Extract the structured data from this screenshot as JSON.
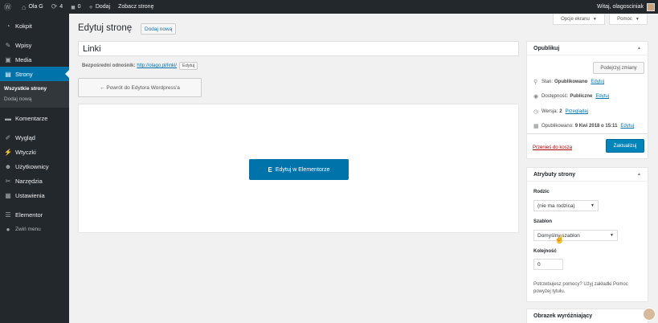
{
  "adminbar": {
    "wp_icon": "wordpress-logo-icon",
    "site": "Ola G",
    "updates": "4",
    "comments": "0",
    "new": "Dodaj",
    "view": "Zobacz stronę",
    "greeting": "Witaj, olagosciniak"
  },
  "sidebar": {
    "items": [
      {
        "label": "Kokpit",
        "icon": "dashboard-icon"
      },
      {
        "label": "Wpisy",
        "icon": "pin-icon"
      },
      {
        "label": "Media",
        "icon": "media-icon"
      },
      {
        "label": "Strony",
        "icon": "pages-icon"
      },
      {
        "label": "Komentarze",
        "icon": "comments-icon"
      },
      {
        "label": "Wygląd",
        "icon": "brush-icon"
      },
      {
        "label": "Wtyczki",
        "icon": "plugin-icon"
      },
      {
        "label": "Użytkownicy",
        "icon": "users-icon"
      },
      {
        "label": "Narzędzia",
        "icon": "tools-icon"
      },
      {
        "label": "Ustawienia",
        "icon": "settings-icon"
      },
      {
        "label": "Elementor",
        "icon": "elementor-icon"
      },
      {
        "label": "Zwiń menu",
        "icon": "collapse-icon"
      }
    ],
    "submenu": [
      "Wszystkie strony",
      "Dodaj nową"
    ]
  },
  "screen_options": "Opcje ekranu",
  "help": "Pomoc",
  "main": {
    "title": "Edytuj stronę",
    "add_new": "Dodaj nową",
    "post_title": "Linki",
    "permalink_label": "Bezpośredni odnośnik:",
    "permalink_url": "http://olago.pl/linki/",
    "permalink_edit": "Edytuj",
    "back_button": "← Powrót do Edytora Wordpress'a",
    "elementor_button": "Edytuj w Elementorze",
    "elementor_glyph": "E"
  },
  "publish": {
    "title": "Opublikuj",
    "preview": "Podejrzyj zmiany",
    "status_label": "Stan:",
    "status_value": "Opublikowano",
    "visibility_label": "Dostępność:",
    "visibility_value": "Publiczne",
    "revisions_label": "Wersja:",
    "revisions_value": "2",
    "revisions_link": "Przeglądaj",
    "published_label": "Opublikowano:",
    "published_value": "9 Kwi 2018 o 15:11",
    "edit": "Edytuj",
    "trash": "Przenieś do kosza",
    "update": "Zaktualizuj"
  },
  "attributes": {
    "title": "Atrybuty strony",
    "parent_label": "Rodzic",
    "parent_value": "(nie ma rodzica)",
    "template_label": "Szablon",
    "template_value": "Domyślny szablon",
    "order_label": "Kolejność",
    "order_value": "0",
    "help": "Potrzebujesz pomocy? Użyj zakładki Pomoc powyżej tytułu."
  },
  "featured": {
    "title": "Obrazek wyróżniający"
  }
}
